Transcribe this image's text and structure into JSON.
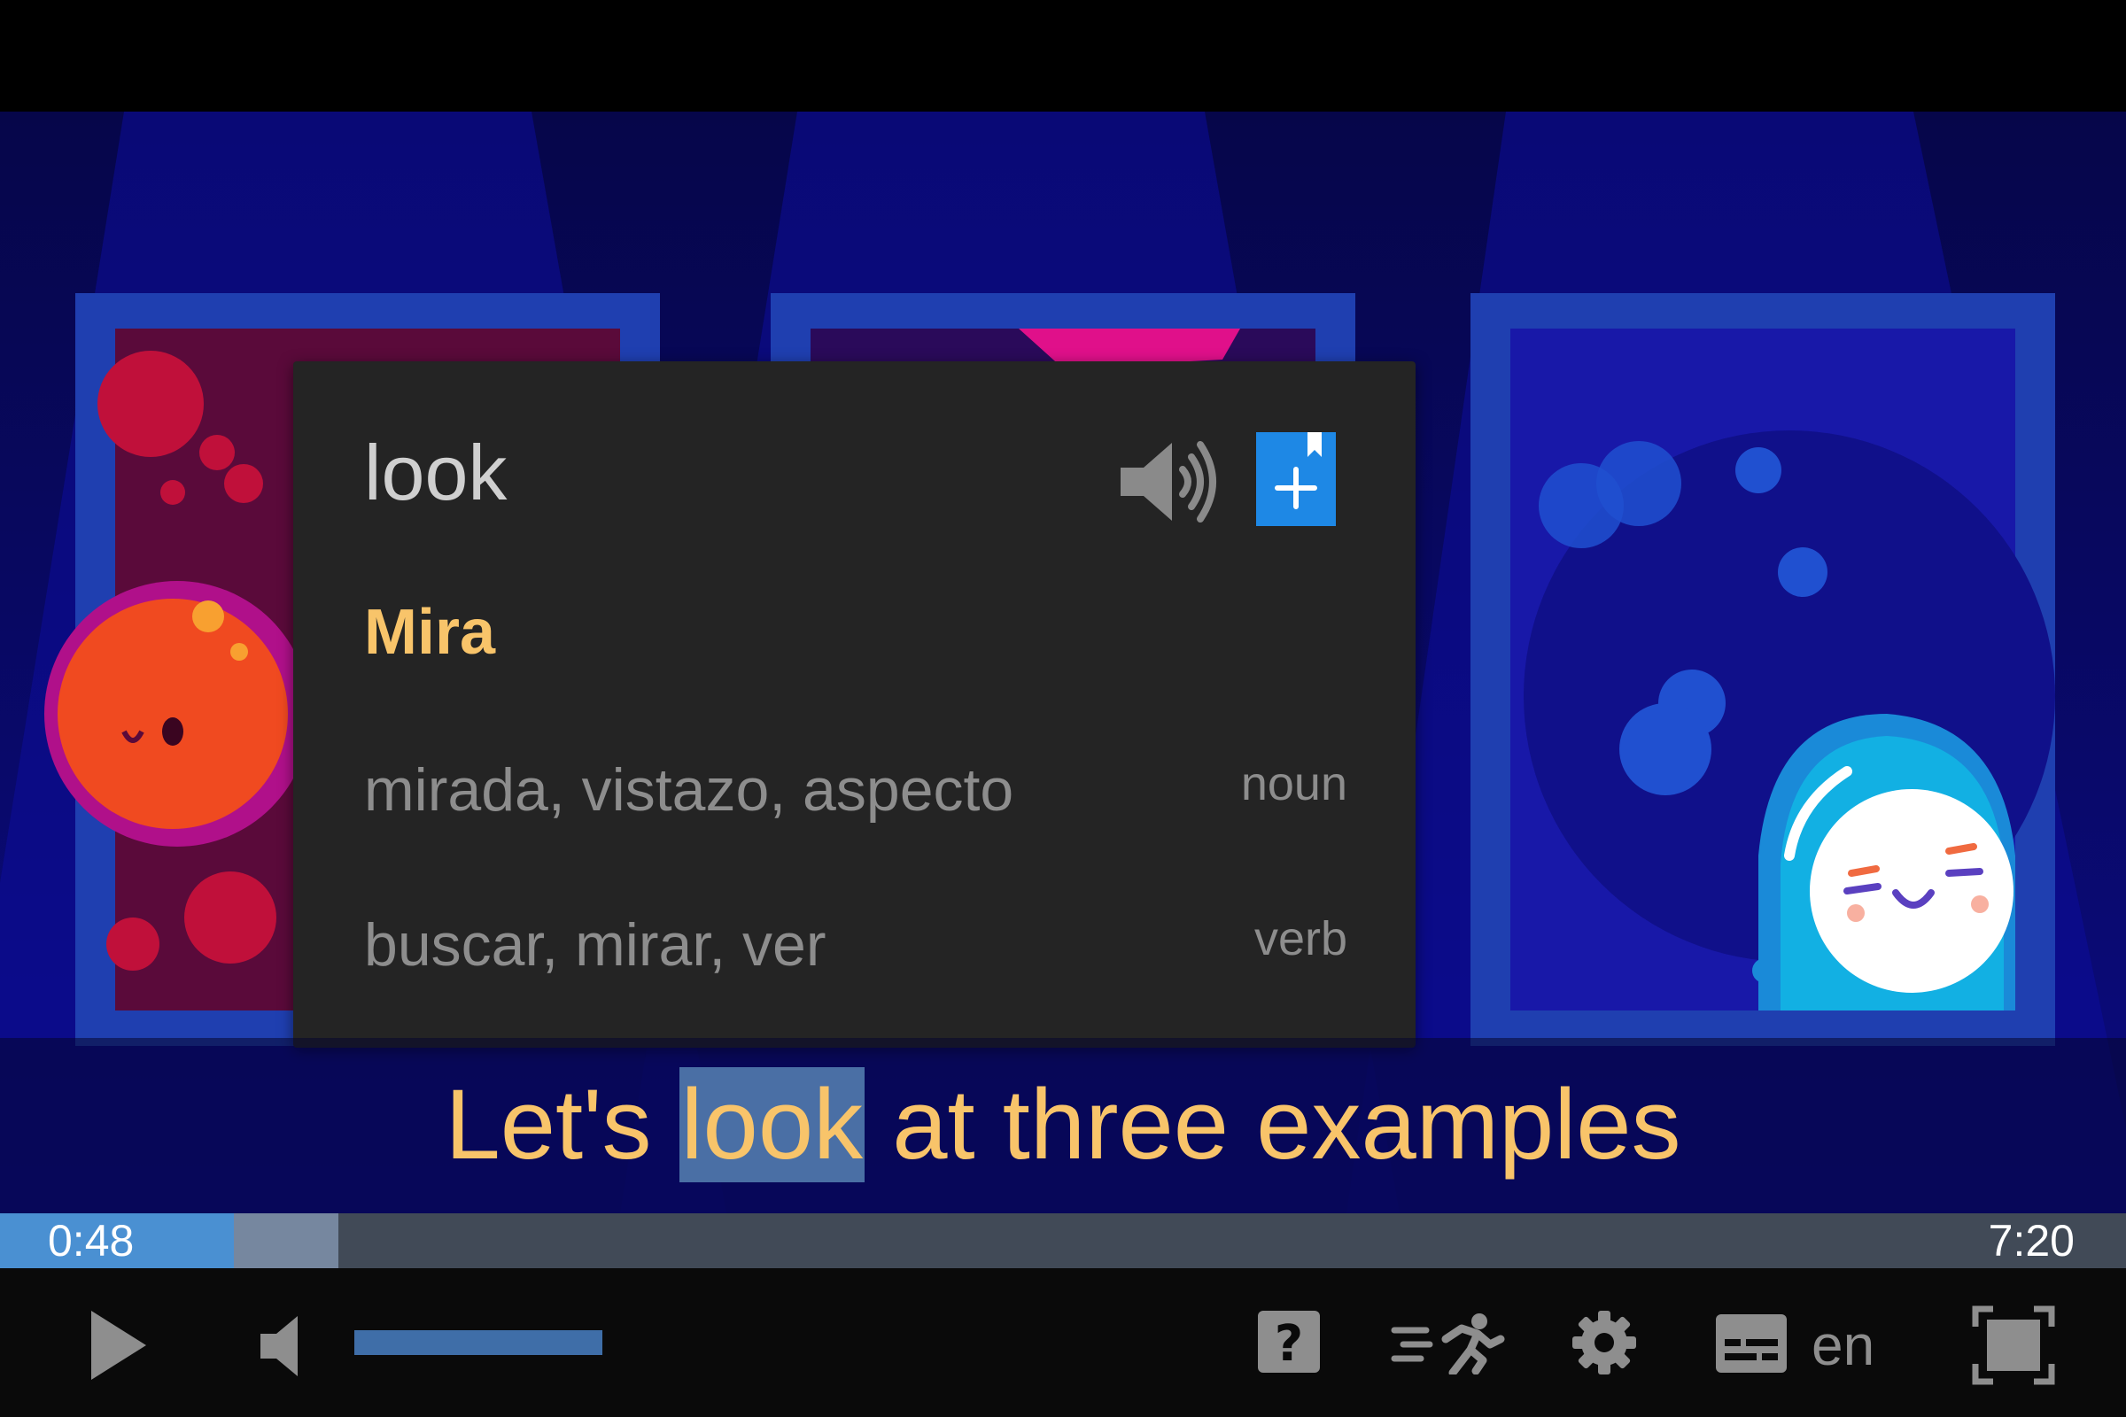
{
  "popup": {
    "word": "look",
    "main_translation": "Mira",
    "meanings": [
      {
        "words": "mirada, vistazo, aspecto",
        "pos": "noun"
      },
      {
        "words": "buscar, mirar, ver",
        "pos": "verb"
      }
    ],
    "icons": {
      "speaker": "speaker-icon",
      "add": "bookmark-add-icon"
    }
  },
  "subtitle": {
    "before": "Let's ",
    "highlight": "look",
    "after": " at three examples"
  },
  "player": {
    "current_time": "0:48",
    "duration": "7:20",
    "played_fraction": 0.11,
    "buffered_fraction": 0.159,
    "volume_fraction": 0.65,
    "language": "en"
  },
  "colors": {
    "accent_yellow": "#f8c46a",
    "highlight": "#4a6fa5",
    "progress_played": "#4a90d2",
    "add_button": "#1e88e5"
  }
}
